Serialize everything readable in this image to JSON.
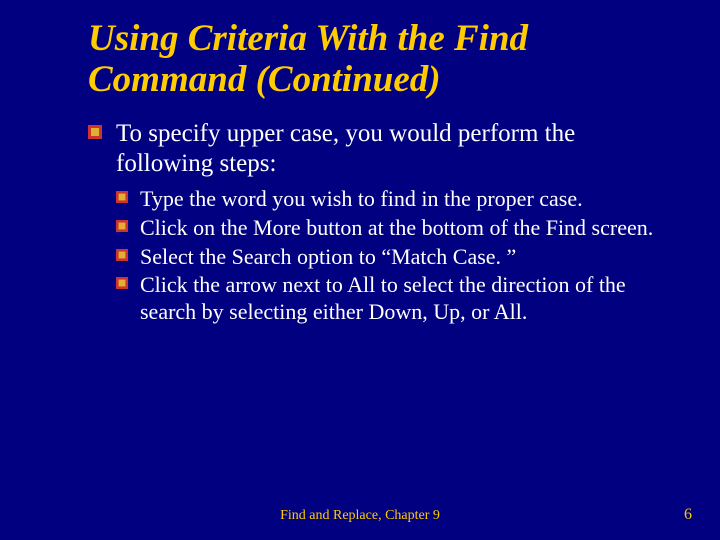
{
  "title": "Using Criteria With the Find Command (Continued)",
  "level1_text": "To specify upper case, you would perform the following steps:",
  "sub": [
    "Type the word you wish to find in the proper case.",
    "Click on the More button at the bottom of the Find screen.",
    "Select the Search option to “Match Case. ”",
    "Click the arrow next to All to select the direction of the search by selecting either Down, Up, or All."
  ],
  "footer": "Find and Replace, Chapter 9",
  "page_number": "6",
  "colors": {
    "background": "#000080",
    "accent": "#ffcc00",
    "bullet_red": "#cc3333",
    "bullet_gold": "#e0b030"
  }
}
